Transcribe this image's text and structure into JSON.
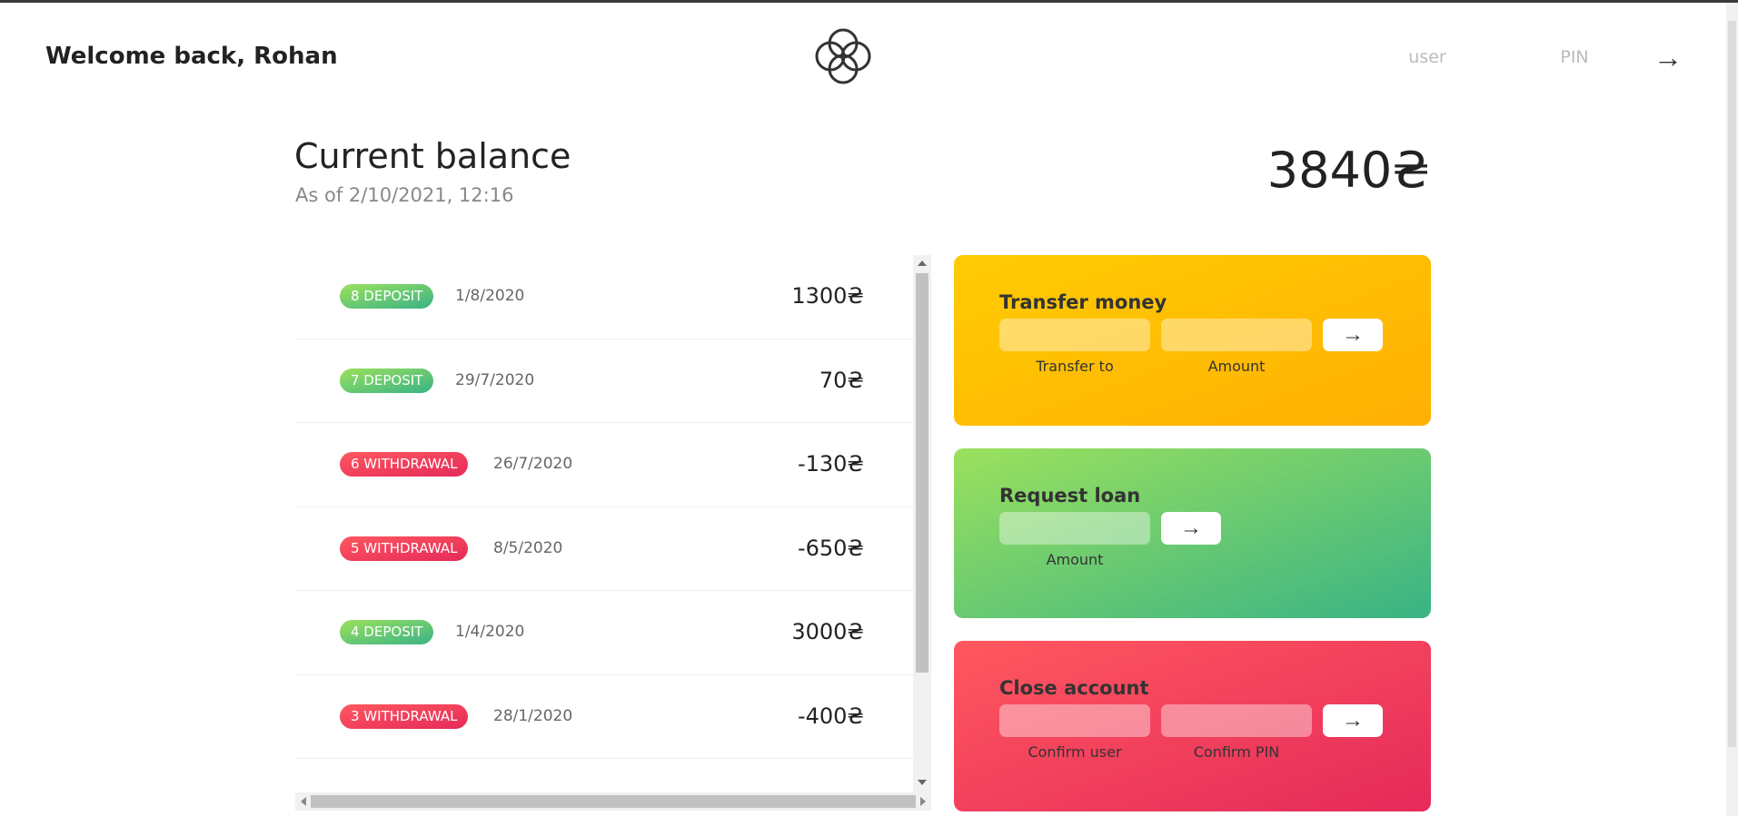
{
  "nav": {
    "welcome": "Welcome back, Rohan",
    "logo_icon": "four-circles-logo-icon",
    "user_placeholder": "user",
    "pin_placeholder": "PIN",
    "login_button": "→"
  },
  "balance": {
    "label": "Current balance",
    "date_text": "As of 2/10/2021, 12:16",
    "value": "3840₴"
  },
  "movements": [
    {
      "type_label": "8 DEPOSIT",
      "kind": "deposit",
      "date": "1/8/2020",
      "value": "1300₴"
    },
    {
      "type_label": "7 DEPOSIT",
      "kind": "deposit",
      "date": "29/7/2020",
      "value": "70₴"
    },
    {
      "type_label": "6 WITHDRAWAL",
      "kind": "withdrawal",
      "date": "26/7/2020",
      "value": "-130₴"
    },
    {
      "type_label": "5 WITHDRAWAL",
      "kind": "withdrawal",
      "date": "8/5/2020",
      "value": "-650₴"
    },
    {
      "type_label": "4 DEPOSIT",
      "kind": "deposit",
      "date": "1/4/2020",
      "value": "3000₴"
    },
    {
      "type_label": "3 WITHDRAWAL",
      "kind": "withdrawal",
      "date": "28/1/2020",
      "value": "-400₴"
    }
  ],
  "operations": {
    "transfer": {
      "title": "Transfer money",
      "to_label": "Transfer to",
      "amount_label": "Amount",
      "button": "→",
      "color_from": "#ffcb03",
      "color_to": "#ffb003"
    },
    "loan": {
      "title": "Request loan",
      "amount_label": "Amount",
      "button": "→",
      "color_from": "#9be15d",
      "color_to": "#39b385"
    },
    "close": {
      "title": "Close account",
      "user_label": "Confirm user",
      "pin_label": "Confirm PIN",
      "button": "→",
      "color_from": "#ff585f",
      "color_to": "#e52a5a"
    }
  }
}
